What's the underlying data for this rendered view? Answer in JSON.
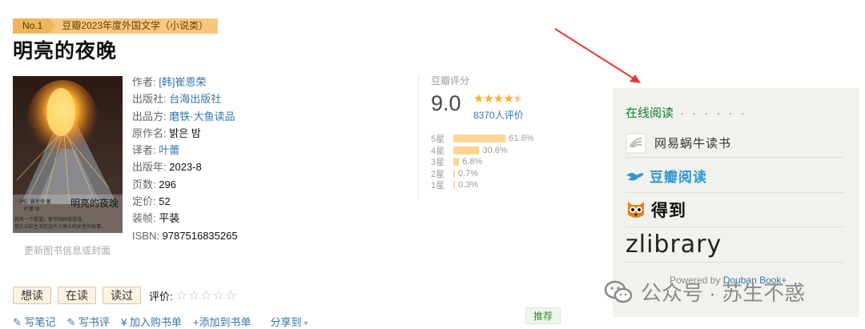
{
  "badge": {
    "no": "No.1",
    "rank": "豆瓣2023年度外国文学（小说类）"
  },
  "book": {
    "title": "明亮的夜晚",
    "cover_title": "明亮的夜晚",
    "cover_author_line": "［韩］崔恩荣 著",
    "cover_translator_line": "叶蕾 译",
    "cover_blurb_1": "我有一个愿望，那写妈妈或祖母，",
    "cover_blurb_2": "很久以前生活在这片土地上的女性的故事。",
    "cover_update": "更新图书信息或封面"
  },
  "info": [
    {
      "label": "作者:",
      "value": "[韩]崔恩荣",
      "link": true
    },
    {
      "label": "出版社:",
      "value": "台海出版社",
      "link": true
    },
    {
      "label": "出品方:",
      "value": "磨铁·大鱼读品",
      "link": true
    },
    {
      "label": "原作名:",
      "value": "밝은 밤",
      "link": false
    },
    {
      "label": "译者:",
      "value": "叶蕾",
      "link": true
    },
    {
      "label": "出版年:",
      "value": "2023-8",
      "link": false
    },
    {
      "label": "页数:",
      "value": "296",
      "link": false
    },
    {
      "label": "定价:",
      "value": "52",
      "link": false
    },
    {
      "label": "装帧:",
      "value": "平装",
      "link": false
    },
    {
      "label": "ISBN:",
      "value": "9787516835265",
      "link": false
    }
  ],
  "rating": {
    "label": "豆瓣评分",
    "score": "9.0",
    "stars": 4.5,
    "stars_text": "★★★★★",
    "count": "8370人评价",
    "distribution": [
      {
        "star": "5星",
        "percent": 61.6,
        "label": "61.6%"
      },
      {
        "star": "4星",
        "percent": 30.6,
        "label": "30.6%"
      },
      {
        "star": "3星",
        "percent": 6.8,
        "label": "6.8%"
      },
      {
        "star": "2星",
        "percent": 0.7,
        "label": "0.7%"
      },
      {
        "star": "1星",
        "percent": 0.3,
        "label": "0.3%"
      }
    ]
  },
  "actions": {
    "want": "想读",
    "reading": "在读",
    "read": "读过",
    "rate_label": "评价:",
    "rate_stars": "☆☆☆☆☆"
  },
  "links": {
    "note": "写笔记",
    "review": "写书评",
    "cart": "加入购书单",
    "booklist": "添加到书单",
    "share": "分享到",
    "recommend": "推荐"
  },
  "online": {
    "title": "在线阅读",
    "dots": "· · · · · ·",
    "vendors": [
      "网易蜗牛读书",
      "豆瓣阅读",
      "得到",
      "zlibrary"
    ],
    "powered_prefix": "Powered by ",
    "powered_link": "Douban Book+"
  },
  "watermark": {
    "text": "公众号 · 苏生不惑"
  },
  "colors": {
    "arrow": "#e53935",
    "star": "#ffac2d",
    "bar": "#ffd596",
    "online_title": "#0f7a2a",
    "link": "#3377aa"
  }
}
